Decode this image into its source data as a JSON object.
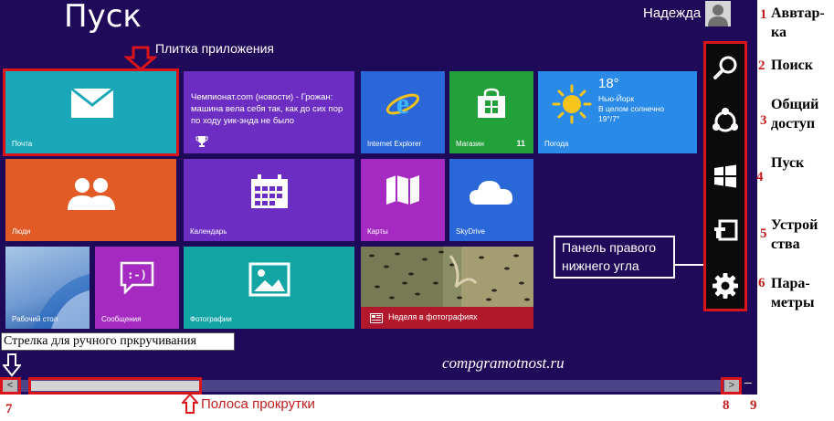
{
  "header": {
    "title": "Пуск",
    "user_name": "Надежда"
  },
  "tiles": {
    "mail": {
      "label": "Почта",
      "color": "#1aa8b8"
    },
    "news": {
      "text": "Чемпионат.com (новости) - Грожан: машина вела себя так, как до сих пор по ходу уик-энда не было",
      "color": "#6c2ec2"
    },
    "ie": {
      "label": "Internet Explorer",
      "color": "#2a67d8"
    },
    "store": {
      "label": "Магазин",
      "badge": "11",
      "color": "#22a03a"
    },
    "weather": {
      "label": "Погода",
      "temp": "18°",
      "city": "Нью-Йорк",
      "condition": "В целом солнечно",
      "range": "19°/7°",
      "color": "#2a8ae8"
    },
    "people": {
      "label": "Люди",
      "color": "#e25a26"
    },
    "calendar": {
      "label": "Календарь",
      "color": "#6c2ec2"
    },
    "maps": {
      "label": "Карты",
      "color": "#a52ac2"
    },
    "skydrive": {
      "label": "SkyDrive",
      "color": "#2a67d8"
    },
    "desktop": {
      "label": "Рабочий стол"
    },
    "messaging": {
      "label": "Сообщения",
      "color": "#a52ac2"
    },
    "photos": {
      "label": "Фотографии",
      "color": "#13a4a4"
    },
    "photo_week": {
      "label": "Неделя в фотографиях"
    }
  },
  "annotations": {
    "app_tile": "Плитка приложения",
    "charms_panel": [
      "Панель правого",
      "нижнего угла"
    ],
    "scroll_arrow": "Стрелка для ручного пркручивания",
    "watermark": "compgramotnost.ru",
    "scrollbar": "Полоса  прокрутки",
    "side_items": [
      {
        "num": "1",
        "lines": [
          "Аввтар-",
          "ка"
        ]
      },
      {
        "num": "2",
        "lines": [
          "Поиск"
        ]
      },
      {
        "num": "3",
        "lines": [
          "Общий",
          "доступ"
        ]
      },
      {
        "num": "4",
        "lines": [
          "Пуск"
        ]
      },
      {
        "num": "5",
        "lines": [
          "Устрой",
          "ства"
        ]
      },
      {
        "num": "6",
        "lines": [
          "Пара-",
          "метры"
        ]
      }
    ],
    "bottom_nums": [
      "7",
      "8",
      "9"
    ]
  },
  "scrollbar": {
    "left_arrow": "<",
    "right_arrow": ">",
    "minimize": "–"
  },
  "colors": {
    "background": "#1e0a58",
    "annotation_red": "#d9141b",
    "charms_bg": "#0b0b0b"
  }
}
